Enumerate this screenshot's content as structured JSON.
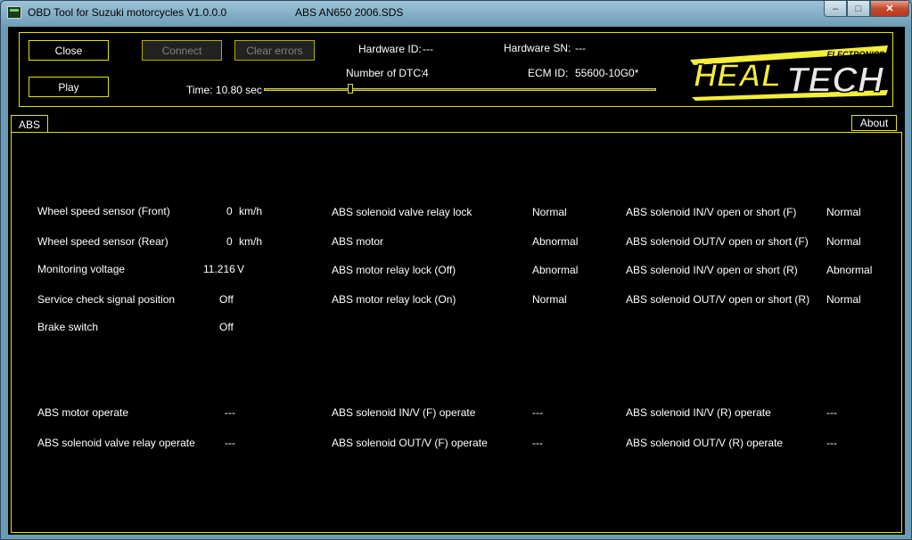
{
  "window": {
    "title": "OBD Tool for Suzuki motorcycles V1.0.0.0",
    "file": "ABS AN650 2006.SDS",
    "controls": {
      "minimize": "–",
      "maximize": "□",
      "close": "✕"
    }
  },
  "toolbar": {
    "close_label": "Close",
    "play_label": "Play",
    "connect_label": "Connect",
    "clear_errors_label": "Clear errors",
    "time_label": "Time: 10.80 sec",
    "time_value_sec": 10.8
  },
  "info": {
    "hardware_id_label": "Hardware ID:",
    "hardware_id_value": "---",
    "dtc_label": "Number of DTC:",
    "dtc_value": "4",
    "hardware_sn_label": "Hardware SN:",
    "hardware_sn_value": "---",
    "ecm_label": "ECM ID:",
    "ecm_value": "55600-10G0*"
  },
  "logo": {
    "small": "ELECTRONICS",
    "heal": "HEAL",
    "tech": "TECH"
  },
  "tabs": {
    "abs": "ABS",
    "about": "About"
  },
  "sensors": [
    {
      "label": "Wheel speed sensor (Front)",
      "value": "0",
      "unit": "km/h"
    },
    {
      "label": "Wheel speed sensor (Rear)",
      "value": "0",
      "unit": "km/h"
    },
    {
      "label": "Monitoring voltage",
      "value": "11.216",
      "unit": "V"
    },
    {
      "label": "Service check signal position",
      "value": "Off",
      "unit": ""
    },
    {
      "label": "Brake switch",
      "value": "Off",
      "unit": ""
    }
  ],
  "relays": [
    {
      "label": "ABS solenoid valve relay lock",
      "value": "Normal"
    },
    {
      "label": "ABS motor",
      "value": "Abnormal"
    },
    {
      "label": "ABS motor relay lock (Off)",
      "value": "Abnormal"
    },
    {
      "label": "ABS motor relay lock (On)",
      "value": "Normal"
    }
  ],
  "solenoids": [
    {
      "label": "ABS solenoid IN/V open or short (F)",
      "value": "Normal"
    },
    {
      "label": "ABS solenoid OUT/V open or short (F)",
      "value": "Normal"
    },
    {
      "label": "ABS solenoid IN/V open or short (R)",
      "value": "Abnormal"
    },
    {
      "label": "ABS solenoid OUT/V open or short (R)",
      "value": "Normal"
    }
  ],
  "operate": [
    {
      "label": "ABS motor operate",
      "value": "---"
    },
    {
      "label": "ABS solenoid valve relay operate",
      "value": "---"
    },
    {
      "label": "ABS solenoid IN/V (F) operate",
      "value": "---"
    },
    {
      "label": "ABS solenoid OUT/V (F) operate",
      "value": "---"
    },
    {
      "label": "ABS solenoid IN/V (R) operate",
      "value": "---"
    },
    {
      "label": "ABS solenoid OUT/V (R) operate",
      "value": "---"
    }
  ],
  "colors": {
    "accent": "#e5e300",
    "background": "#000000",
    "text": "#ffffff"
  }
}
